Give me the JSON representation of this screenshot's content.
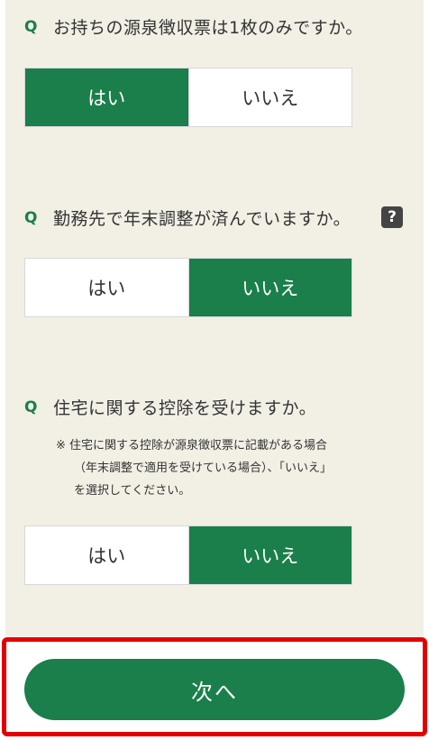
{
  "questions": [
    {
      "mark": "Q",
      "text": "お持ちの源泉徴収票は1枚のみですか。",
      "options": [
        "はい",
        "いいえ"
      ],
      "selected": "はい"
    },
    {
      "mark": "Q",
      "text": "勤務先で年末調整が済んでいますか。",
      "help_icon": "?",
      "options": [
        "はい",
        "いいえ"
      ],
      "selected": "いいえ"
    },
    {
      "mark": "Q",
      "text": "住宅に関する控除を受けますか。",
      "note_lines": [
        "※ 住宅に関する控除が源泉徴収票に記載がある場合",
        "（年末調整で適用を受けている場合）、「いいえ」",
        "を選択してください。"
      ],
      "options": [
        "はい",
        "いいえ"
      ],
      "selected": "いいえ"
    }
  ],
  "footer": {
    "next_label": "次へ"
  },
  "colors": {
    "accent_green": "#1a7f4b",
    "panel_bg": "#f2efe5",
    "highlight_red": "#e30000"
  }
}
